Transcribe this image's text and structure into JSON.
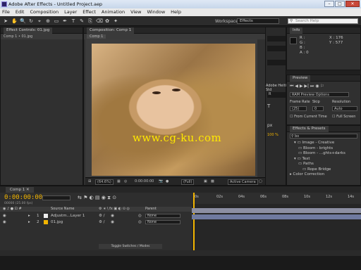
{
  "window": {
    "title": "Adobe After Effects - Untitled Project.aep"
  },
  "menu": [
    "File",
    "Edit",
    "Composition",
    "Layer",
    "Effect",
    "Animation",
    "View",
    "Window",
    "Help"
  ],
  "toolbar": {
    "workspace_label": "Workspace:",
    "workspace_value": "Effects",
    "search_placeholder": "Search Help"
  },
  "effect_controls": {
    "tab": "Effect Controls: 01.jpg",
    "subtitle": "Comp 1 • 01.jpg"
  },
  "composition": {
    "tab": "Composition: Comp 1",
    "subtab": "Comp 1",
    "overlay_text": "www.cg-ku.com",
    "zoom": "(64.6%)",
    "timecode": "0:00:00:00",
    "resolution": "(Full)",
    "camera": "Active Camera"
  },
  "character": {
    "font": "Adobe Heiti Std",
    "style": "R",
    "size_label": "px",
    "leading": "100 %"
  },
  "info": {
    "tab": "Info",
    "R": "R :",
    "G": "G :",
    "B": "B :",
    "A": "A : 0",
    "X": "X : 176",
    "Y": "Y : 577"
  },
  "preview": {
    "tab": "Preview",
    "options": "RAM Preview Options",
    "frame_rate_label": "Frame Rate",
    "skip_label": "Skip",
    "resolution_label": "Resolution",
    "frame_rate_value": "(25)",
    "skip_value": "0",
    "resolution_value": "Auto",
    "from_current": "From Current Time",
    "full_screen": "Full Screen"
  },
  "effects_presets": {
    "tab": "Effects & Presets",
    "search": "bo",
    "items": [
      {
        "label": "Image - Creative",
        "indent": 1
      },
      {
        "label": "Bloom - brights",
        "indent": 2
      },
      {
        "label": "Bloom - ...ghts+darks",
        "indent": 2
      },
      {
        "label": "Text",
        "indent": 1
      },
      {
        "label": "Paths",
        "indent": 2
      },
      {
        "label": "Rope Bridge",
        "indent": 3
      },
      {
        "label": "Color Correction",
        "indent": 0
      }
    ]
  },
  "timeline": {
    "tab": "Comp 1",
    "timecode": "0:00:00:00",
    "frames": "00000 (25.00 fps)",
    "col_source": "Source Name",
    "col_parent": "Parent",
    "ticks": [
      "0s",
      "02s",
      "04s",
      "06s",
      "08s",
      "10s",
      "12s",
      "14s"
    ],
    "layers": [
      {
        "num": "1",
        "name": "Adjustm...Layer 1",
        "parent": "None"
      },
      {
        "num": "2",
        "name": "01.jpg",
        "parent": "None"
      }
    ],
    "toggle": "Toggle Switches / Modes"
  },
  "colors": {
    "accent": "#f2b400",
    "layer1": "#8c8fa3",
    "layer2": "#6f7aa0"
  }
}
